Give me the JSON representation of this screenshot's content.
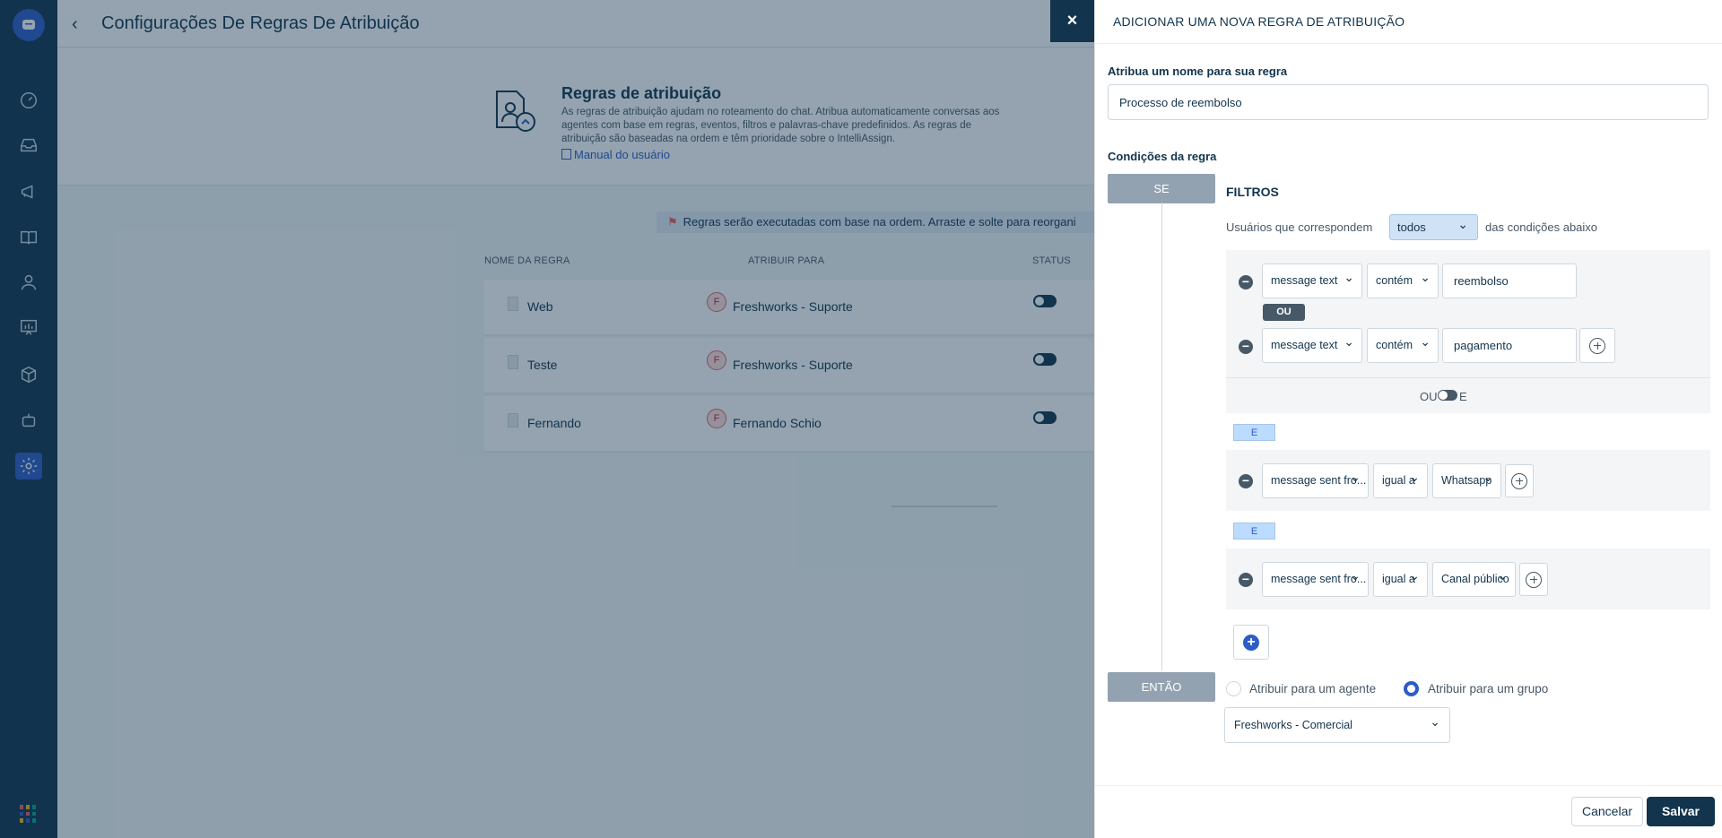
{
  "page": {
    "title": "Configurações De Regras De Atribuição"
  },
  "hero": {
    "title": "Regras de atribuição",
    "description": "As regras de atribuição ajudam no roteamento do chat. Atribua automaticamente conversas aos agentes com base em regras, eventos, filtros e palavras-chave predefinidos. As regras de atribuição são baseadas na ordem e têm prioridade sobre o IntelliAssign.",
    "manual_link": "Manual do usuário"
  },
  "notice": "Regras serão executadas com base na ordem. Arraste e solte para reorgani",
  "table": {
    "headers": [
      "NOME DA REGRA",
      "ATRIBUIR PARA",
      "STATUS"
    ],
    "rows": [
      {
        "name": "Web",
        "avatar": "F",
        "assignee": "Freshworks - Suporte"
      },
      {
        "name": "Teste",
        "avatar": "F",
        "assignee": "Freshworks - Suporte"
      },
      {
        "name": "Fernando",
        "avatar": "F",
        "assignee": "Fernando Schio"
      }
    ]
  },
  "panel": {
    "close": "×",
    "title": "ADICIONAR UMA NOVA REGRA DE ATRIBUIÇÃO",
    "name_label": "Atribua um nome para sua regra",
    "name_value": "Processo de reembolso",
    "conditions_label": "Condições da regra",
    "if_label": "SE",
    "filters_title": "FILTROS",
    "match_prefix": "Usuários que correspondem",
    "match_value": "todos",
    "match_suffix": "das condições abaixo",
    "ou_badge": "OU",
    "ou_toggle_left": "OU",
    "ou_toggle_right": "E",
    "and_badge": "E",
    "conditions": [
      {
        "field": "message text",
        "op": "contém",
        "value": "reembolso"
      },
      {
        "field": "message text",
        "op": "contém",
        "value": "pagamento"
      },
      {
        "field": "message sent fro...",
        "op": "igual a",
        "value": "Whatsapp"
      },
      {
        "field": "message sent fro...",
        "op": "igual a",
        "value": "Canal público"
      }
    ],
    "then_label": "ENTÃO",
    "radio_agent": "Atribuir para um agente",
    "radio_group": "Atribuir para um grupo",
    "group_value": "Freshworks - Comercial",
    "cancel": "Cancelar",
    "save": "Salvar"
  },
  "colors": {
    "sidebar": "#12344d",
    "accent": "#2c5cc5",
    "overlay": "rgba(18,52,77,.45)"
  }
}
